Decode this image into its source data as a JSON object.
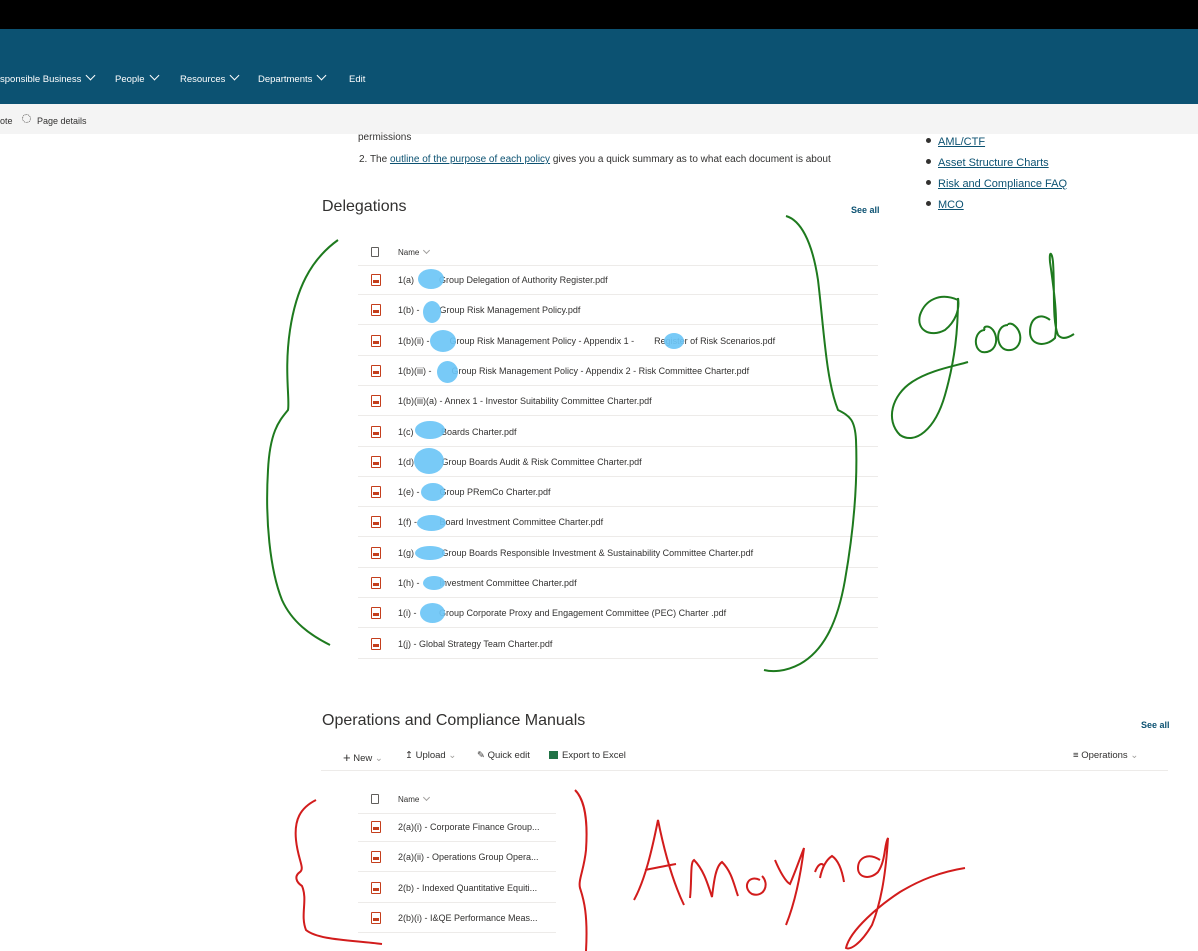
{
  "nav": {
    "items": [
      {
        "label": "sponsible Business"
      },
      {
        "label": "People"
      },
      {
        "label": "Resources"
      },
      {
        "label": "Departments"
      },
      {
        "label": "Edit"
      }
    ]
  },
  "cmdbar": {
    "left_fragment": "ote",
    "page_details": "Page details"
  },
  "intro": {
    "line1": "permissions",
    "line2_num": "2. The ",
    "line2_link": "outline of the purpose of each policy",
    "line2_rest": " gives you a quick summary as to what each document is about"
  },
  "right_links": [
    "AML/CTF",
    "Asset Structure Charts",
    "Risk and Compliance FAQ",
    "MCO"
  ],
  "delegations": {
    "title": "Delegations",
    "see_all": "See all",
    "name_header": "Name",
    "files": [
      {
        "name": "1(a)          Group Delegation of Authority Register.pdf"
      },
      {
        "name": "1(b) -        Group Risk Management Policy.pdf"
      },
      {
        "name": "1(b)(ii) -        Group Risk Management Policy - Appendix 1 -        Register of Risk Scenarios.pdf"
      },
      {
        "name": "1(b)(iii) -        Group Risk Management Policy - Appendix 2 - Risk Committee Charter.pdf"
      },
      {
        "name": "1(b)(iii)(a) - Annex 1 - Investor Suitability Committee Charter.pdf"
      },
      {
        "name": "1(c)           Boards Charter.pdf"
      },
      {
        "name": "1(d)           Group Boards Audit & Risk Committee Charter.pdf"
      },
      {
        "name": "1(e) -        Group PRemCo Charter.pdf"
      },
      {
        "name": "1(f) -         Board Investment Committee Charter.pdf"
      },
      {
        "name": "1(g)           Group Boards Responsible Investment & Sustainability Committee Charter.pdf"
      },
      {
        "name": "1(h) -        Investment Committee Charter.pdf"
      },
      {
        "name": "1(i) -         Group Corporate Proxy and Engagement Committee (PEC) Charter .pdf"
      },
      {
        "name": "1(j) - Global Strategy Team Charter.pdf"
      }
    ]
  },
  "operations": {
    "title": "Operations and Compliance Manuals",
    "see_all": "See all",
    "toolbar": {
      "new": "New",
      "upload": "Upload",
      "quick_edit": "Quick edit",
      "export": "Export to Excel",
      "view": "Operations"
    },
    "name_header": "Name",
    "files": [
      {
        "name": "2(a)(i) - Corporate Finance Group..."
      },
      {
        "name": "2(a)(ii) - Operations Group Opera..."
      },
      {
        "name": "2(b) - Indexed Quantitative Equiti..."
      },
      {
        "name": "2(b)(i) - I&QE Performance Meas..."
      }
    ]
  },
  "annotations": {
    "good": "good",
    "annoying": "Annoying"
  },
  "colors": {
    "nav_bg": "#0c5272",
    "link": "#0c5272",
    "pdf_red": "#c43e1c",
    "green_ink": "#1e7a1e",
    "red_ink": "#d21c1c",
    "blot": "#6cc6f6"
  }
}
